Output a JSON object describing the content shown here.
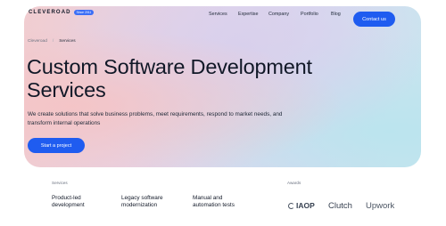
{
  "header": {
    "logo_text": "CLEVEROAD",
    "logo_badge": "Since 2011",
    "nav": [
      "Services",
      "Expertise",
      "Company",
      "Portfolio",
      "Blog"
    ],
    "contact_label": "Contact us"
  },
  "breadcrumb": {
    "home": "Cleveroad",
    "separator": "/",
    "current": "Services"
  },
  "hero": {
    "title": "Custom Software Development Services",
    "description": "We create solutions that solve business problems, meet requirements, respond to market needs, and transform internal operations",
    "cta_label": "Start a project"
  },
  "services": {
    "label": "Services",
    "items": [
      "Product-led development",
      "Legacy software modernization",
      "Manual and automation tests"
    ]
  },
  "awards": {
    "label": "Awards",
    "items": [
      "IAOP",
      "Clutch",
      "Upwork"
    ]
  }
}
